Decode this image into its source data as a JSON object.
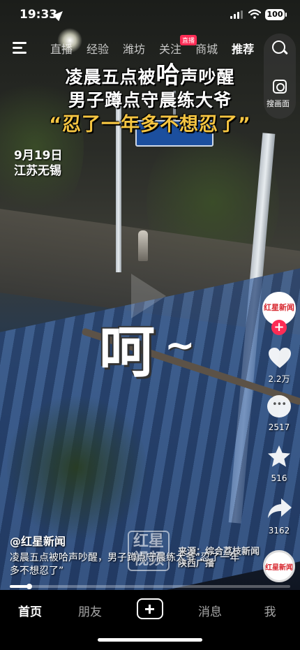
{
  "status_bar": {
    "time": "19:33",
    "battery": "100"
  },
  "top_nav": {
    "tabs": [
      {
        "label": "直播",
        "active": false
      },
      {
        "label": "经验",
        "active": false
      },
      {
        "label": "潍坊",
        "active": false
      },
      {
        "label": "关注",
        "active": false
      },
      {
        "label": "商城",
        "active": false
      },
      {
        "label": "推荐",
        "active": true
      }
    ],
    "live_badge": "直播",
    "scan_label": "搜画面"
  },
  "video": {
    "headline_part1": "凌晨五点被",
    "headline_big": "哈",
    "headline_part2": "声吵醒",
    "subheadline": "男子蹲点守晨练大爷",
    "quote": "“忍了一年多不想忍了”",
    "date": "9月19日",
    "location": "江苏无锡",
    "sfx_text": "呵",
    "sfx_tilde": "~",
    "watermark": "红星\n视频",
    "source": "来源：综合荔枝新闻\n陕西广播"
  },
  "actions": {
    "avatar_text": "红星新闻",
    "follow": "+",
    "likes": "2.2万",
    "comments": "2517",
    "favorites": "516",
    "shares": "3162"
  },
  "post": {
    "author": "@红星新闻",
    "description": "凌晨五点被哈声吵醒，男子蹲点守晨练大爷“忍了一年多不想忍了”",
    "progress_percent": 7
  },
  "tab_bar": {
    "home": "首页",
    "friends": "朋友",
    "messages": "消息",
    "me": "我"
  },
  "colors": {
    "accent": "#fe2c55",
    "quote_yellow": "#f5c542",
    "brand_red": "#d7262e"
  }
}
